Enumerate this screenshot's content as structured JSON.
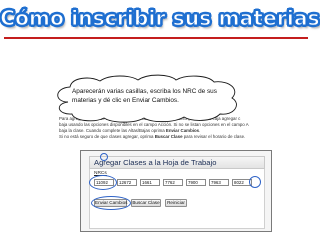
{
  "slide": {
    "title": "Cómo inscribir sus materias",
    "title_outline_color": "#1f6fd0",
    "rule_color": "#c41e1e"
  },
  "callout": {
    "text": "Aparecerán varias casillas, escriba los NRC de sus materias y dé clic en Enviar Cambios."
  },
  "background_text": {
    "line1": "Para agregar una clase ingrese el número de referencia del curso (NRC) en la caja agregar c",
    "line2": "baja usando las opciones disponibles en el campo Acción. Si no se listan opciones en el campo A",
    "line3_a": "baja la clase. Cuando complete las Altas/Bajas oprima ",
    "line3_b": "Enviar Cambios",
    "line3_c": ".",
    "line4_a": "Si no está seguro de que clases agregar, oprima ",
    "line4_b": "Buscar Clase",
    "line4_c": " para revisar el horario de clase."
  },
  "form": {
    "panel_title": "Agregar Clases a la Hoja de Trabajo",
    "nrc_label": "NRCs",
    "nrc_values": [
      "11092",
      "12672",
      "1661",
      "7762",
      "7900",
      "7963",
      "8022"
    ],
    "buttons": {
      "submit": "Enviar Cambios",
      "search": "Buscar Clase",
      "reset": "Reiniciar"
    },
    "highlight_color": "#2f63c7"
  }
}
